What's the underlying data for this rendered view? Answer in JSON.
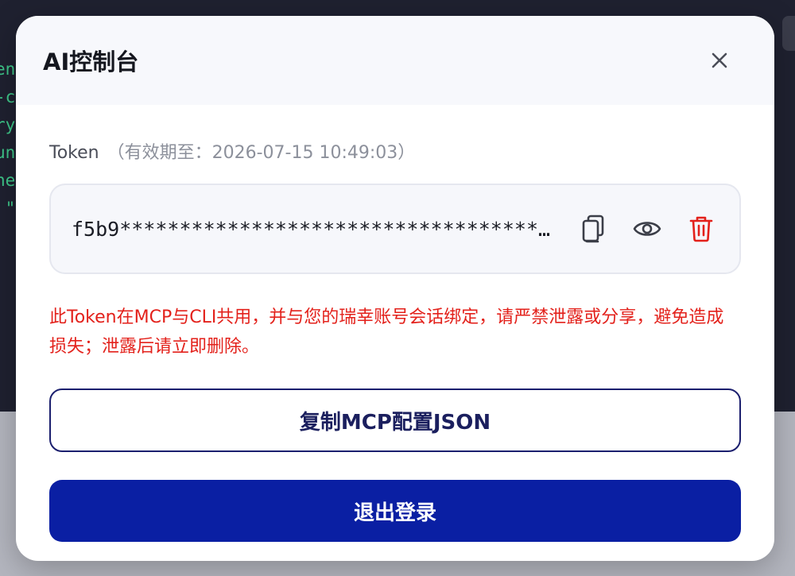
{
  "background": {
    "code_lines": [
      "en",
      "-c",
      "ry",
      "un",
      "ne",
      " \""
    ]
  },
  "modal": {
    "title": "AI控制台",
    "close_icon": "close-icon",
    "token": {
      "label": "Token",
      "expiry": "（有效期至：2026-07-15 10:49:03）",
      "value": "f5b9****************************************************",
      "actions": [
        "copy-icon",
        "eye-icon",
        "trash-icon"
      ]
    },
    "warning": "此Token在MCP与CLI共用，并与您的瑞幸账号会话绑定，请严禁泄露或分享，避免造成损失；泄露后请立即删除。",
    "copy_config_button": "复制MCP配置JSON",
    "logout_button": "退出登录"
  },
  "colors": {
    "warning": "#e3211b",
    "primary": "#0a1fa3",
    "outline": "#1b1f6e",
    "delete": "#e3211b"
  }
}
